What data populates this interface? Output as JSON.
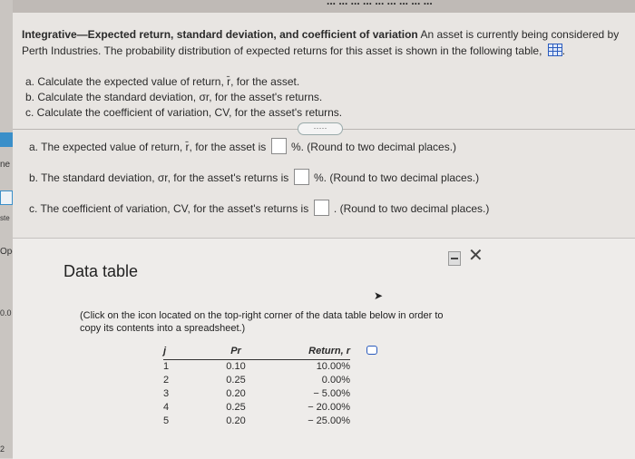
{
  "top_cut_text": "... ... ... ... ... ... ... ... ...",
  "left_panel": {
    "items": [
      "ne",
      "ste",
      "Ope",
      "0.0"
    ],
    "bottom_number": "2"
  },
  "question": {
    "title_bold": "Integrative—Expected return, standard deviation, and coefficient of variation",
    "title_rest": "An asset is currently being considered by Perth Industries. The probability distribution of expected returns for this asset is shown in the following table,",
    "parts": [
      "a. Calculate the expected value of return, r̄, for the asset.",
      "b. Calculate the standard deviation, σr, for the asset's returns.",
      "c. Calculate the coefficient of variation, CV, for the asset's returns."
    ],
    "dots": "·····",
    "answers": [
      {
        "prefix": "a. The expected value of return, r̄, for the asset is",
        "suffix": "%. (Round to two decimal places.)"
      },
      {
        "prefix": "b. The standard deviation, σr, for the asset's returns is",
        "suffix": "%. (Round to two decimal places.)"
      },
      {
        "prefix": "c. The coefficient of variation, CV, for the asset's returns is",
        "suffix": ". (Round to two decimal places.)"
      }
    ]
  },
  "modal": {
    "title": "Data table",
    "close": "✕",
    "instruction": "(Click on the icon located on the top-right corner of the data table below in order to copy its contents into a spreadsheet.)",
    "headers": [
      "j",
      "Pr",
      "Return, r"
    ],
    "rows": [
      [
        "1",
        "0.10",
        "10.00%"
      ],
      [
        "2",
        "0.25",
        "0.00%"
      ],
      [
        "3",
        "0.20",
        "− 5.00%"
      ],
      [
        "4",
        "0.25",
        "− 20.00%"
      ],
      [
        "5",
        "0.20",
        "− 25.00%"
      ]
    ]
  }
}
